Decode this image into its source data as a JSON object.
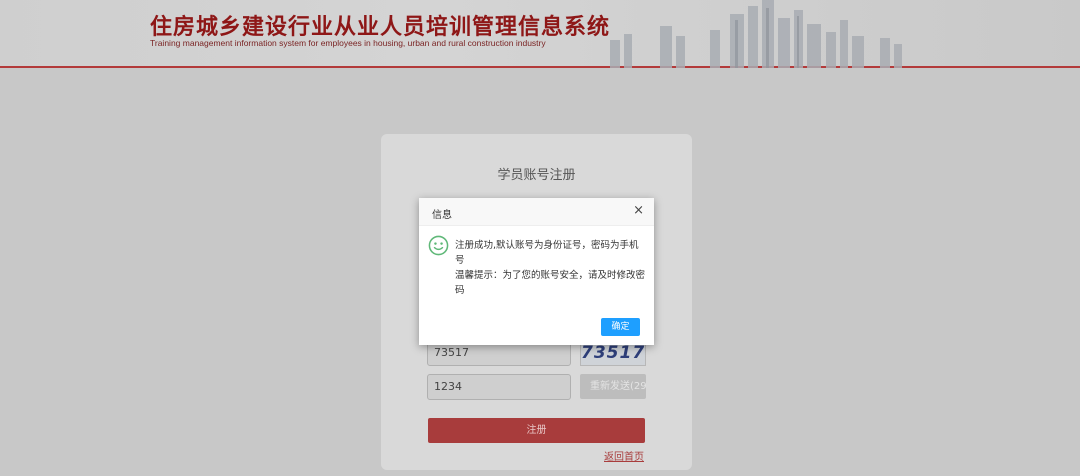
{
  "header": {
    "title_cn": "住房城乡建设行业从业人员培训管理信息系统",
    "title_en": "Training management information system for employees in housing, urban and rural construction industry"
  },
  "form": {
    "title": "学员账号注册",
    "captcha_input_value": "73517",
    "captcha_image_text": "73517",
    "sms_code_value": "1234",
    "resend_label": "重新发送(29",
    "register_label": "注册",
    "back_home_label": "返回首页"
  },
  "dialog": {
    "title": "信息",
    "close_symbol": "×",
    "message_line1": "注册成功,默认账号为身份证号，密码为手机号",
    "message_line2": "温馨提示：为了您的账号安全，请及时修改密码",
    "ok_label": "确定",
    "icon": "smile-icon"
  },
  "colors": {
    "brand_red": "#a83c3c",
    "header_title": "#8e1717",
    "ok_blue": "#1e9fff",
    "smile_green": "#5fb878"
  }
}
